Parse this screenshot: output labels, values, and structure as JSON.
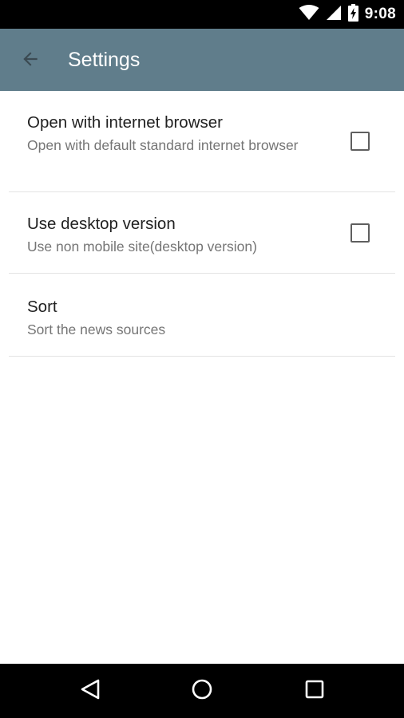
{
  "status_bar": {
    "time": "9:08",
    "icons": [
      "wifi-icon",
      "signal-icon",
      "battery-charging-icon"
    ]
  },
  "app_bar": {
    "title": "Settings",
    "back_icon": "arrow-back-icon",
    "background_color": "#607d8b"
  },
  "preferences": [
    {
      "title": "Open with internet browser",
      "summary": "Open with default standard internet browser",
      "has_checkbox": true,
      "checked": false
    },
    {
      "title": "Use desktop version",
      "summary": "Use non mobile site(desktop version)",
      "has_checkbox": true,
      "checked": false
    },
    {
      "title": "Sort",
      "summary": "Sort the news sources",
      "has_checkbox": false
    }
  ],
  "nav_bar": {
    "icons": [
      "nav-back-icon",
      "nav-home-icon",
      "nav-recents-icon"
    ]
  }
}
